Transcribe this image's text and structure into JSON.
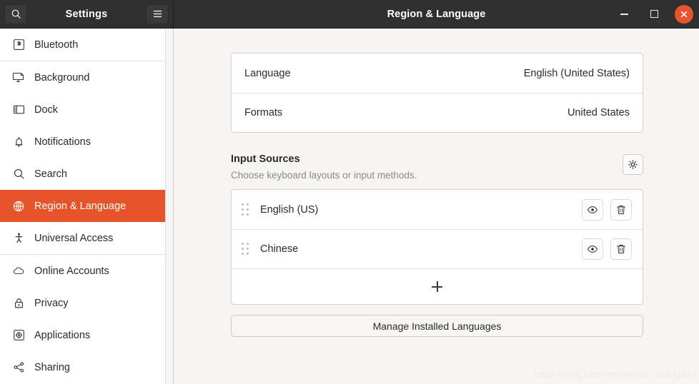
{
  "window": {
    "title": "Region & Language",
    "sidebar_title": "Settings",
    "controls": {
      "minimize": "minimize-button",
      "maximize": "maximize-button",
      "close": "close-button"
    },
    "accent_color": "#e8542a",
    "titlebar_color": "#303030",
    "content_bg": "#f6f5f4"
  },
  "sidebar": {
    "search_label": "Search",
    "menu_label": "Main menu",
    "items": [
      {
        "label": "Bluetooth",
        "icon": "bluetooth-icon",
        "selected": false,
        "separator_after": true
      },
      {
        "label": "Background",
        "icon": "background-icon",
        "selected": false,
        "separator_after": false
      },
      {
        "label": "Dock",
        "icon": "dock-icon",
        "selected": false,
        "separator_after": false
      },
      {
        "label": "Notifications",
        "icon": "bell-icon",
        "selected": false,
        "separator_after": false
      },
      {
        "label": "Search",
        "icon": "search-icon",
        "selected": false,
        "separator_after": false
      },
      {
        "label": "Region & Language",
        "icon": "globe-icon",
        "selected": true,
        "separator_after": false
      },
      {
        "label": "Universal Access",
        "icon": "accessibility-icon",
        "selected": false,
        "separator_after": true
      },
      {
        "label": "Online Accounts",
        "icon": "cloud-icon",
        "selected": false,
        "separator_after": false
      },
      {
        "label": "Privacy",
        "icon": "lock-icon",
        "selected": false,
        "separator_after": false
      },
      {
        "label": "Applications",
        "icon": "applications-gear-icon",
        "selected": false,
        "separator_after": false
      },
      {
        "label": "Sharing",
        "icon": "share-icon",
        "selected": false,
        "separator_after": false
      }
    ]
  },
  "main": {
    "locale_rows": [
      {
        "label": "Language",
        "value": "English (United States)"
      },
      {
        "label": "Formats",
        "value": "United States"
      }
    ],
    "input_sources": {
      "title": "Input Sources",
      "subtitle": "Choose keyboard layouts or input methods.",
      "options_button": "input-source-options",
      "sources": [
        {
          "name": "English (US)"
        },
        {
          "name": "Chinese"
        }
      ],
      "add_label": "Add input source"
    },
    "manage_button": "Manage Installed Languages"
  },
  "watermark": "https://blog.csdn.net/weixin_43941364"
}
